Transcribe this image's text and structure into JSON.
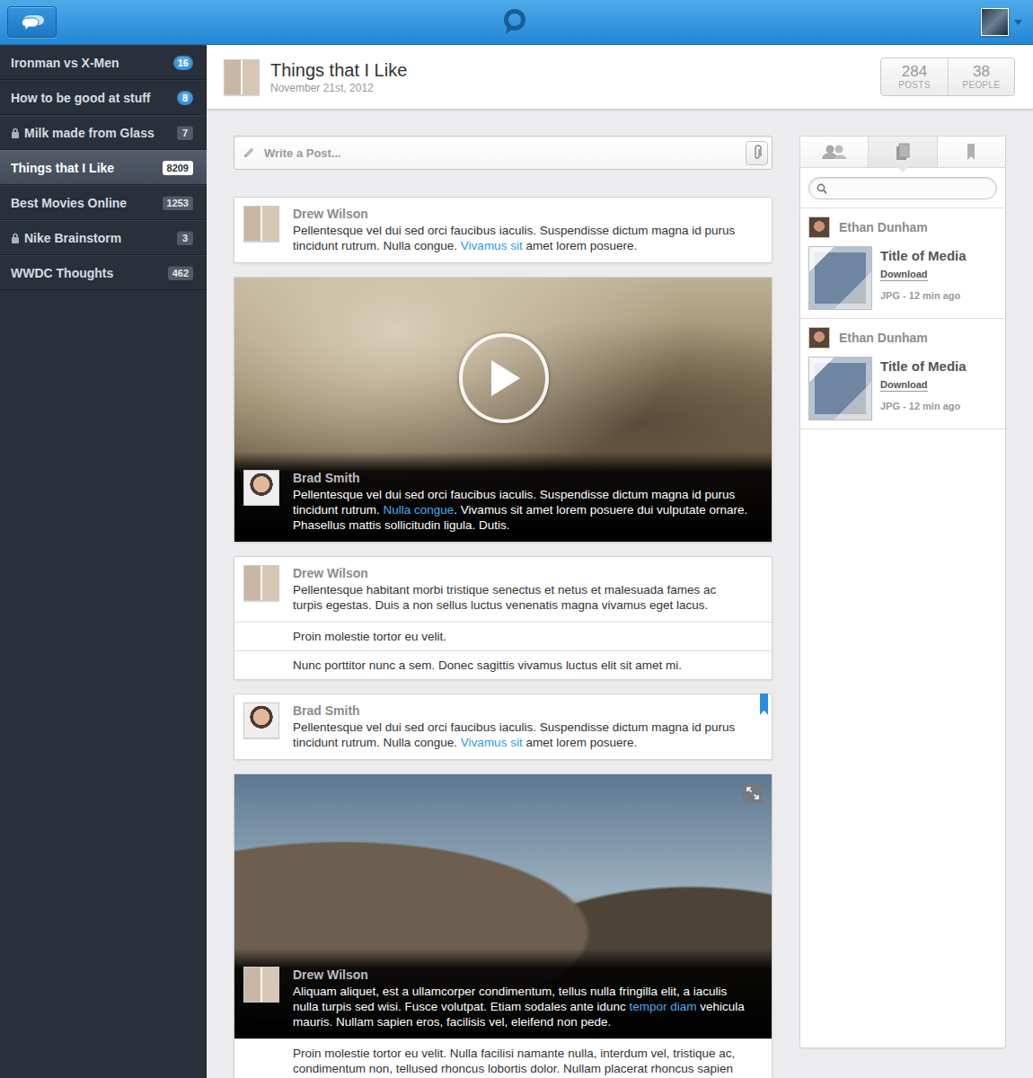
{
  "sidebar": {
    "items": [
      {
        "label": "Ironman vs X-Men",
        "count": "16",
        "locked": false,
        "unread": true,
        "selected": false
      },
      {
        "label": "How to be good at stuff",
        "count": "8",
        "locked": false,
        "unread": true,
        "selected": false
      },
      {
        "label": "Milk made from Glass",
        "count": "7",
        "locked": true,
        "unread": false,
        "selected": false
      },
      {
        "label": "Things that I Like",
        "count": "8209",
        "locked": false,
        "unread": false,
        "selected": true
      },
      {
        "label": "Best Movies Online",
        "count": "1253",
        "locked": false,
        "unread": false,
        "selected": false
      },
      {
        "label": "Nike Brainstorm",
        "count": "3",
        "locked": true,
        "unread": false,
        "selected": false
      },
      {
        "label": "WWDC Thoughts",
        "count": "462",
        "locked": false,
        "unread": false,
        "selected": false
      }
    ]
  },
  "header": {
    "title": "Things that I Like",
    "date": "November 21st, 2012",
    "stats": [
      {
        "value": "284",
        "label": "POSTS"
      },
      {
        "value": "38",
        "label": "PEOPLE"
      }
    ]
  },
  "composer": {
    "placeholder": "Write a Post..."
  },
  "feed": [
    {
      "kind": "text",
      "author": "Drew Wilson",
      "bookmarked": false,
      "segments": [
        {
          "text": "Pellentesque vel dui sed orci faucibus iaculis. Suspendisse dictum magna id purus tincidunt rutrum. Nulla congue. ",
          "link": false
        },
        {
          "text": "Vivamus sit",
          "link": true
        },
        {
          "text": " amet lorem posuere.",
          "link": false
        }
      ],
      "replies": []
    },
    {
      "kind": "video",
      "author": "Brad Smith",
      "bookmarked": false,
      "segments": [
        {
          "text": "Pellentesque vel dui sed orci faucibus iaculis. Suspendisse dictum magna id purus tincidunt rutrum. ",
          "link": false
        },
        {
          "text": "Nulla congue",
          "link": true
        },
        {
          "text": ". Vivamus sit amet lorem posuere dui vulputate ornare. Phasellus mattis sollicitudin ligula. Dutis.",
          "link": false
        }
      ],
      "replies": []
    },
    {
      "kind": "text",
      "author": "Drew Wilson",
      "bookmarked": false,
      "segments": [
        {
          "text": "Pellentesque habitant morbi tristique senectus et netus et malesuada fames ac turpis egestas. Duis a non sellus luctus venenatis magna vivamus eget lacus.",
          "link": false
        }
      ],
      "replies": [
        "Proin molestie tortor eu velit.",
        "Nunc porttitor nunc a sem. Donec sagittis vivamus luctus elit sit amet mi."
      ]
    },
    {
      "kind": "text",
      "author": "Brad Smith",
      "bookmarked": true,
      "segments": [
        {
          "text": "Pellentesque vel dui sed orci faucibus iaculis. Suspendisse dictum magna id purus tincidunt rutrum. Nulla congue. ",
          "link": false
        },
        {
          "text": "Vivamus sit",
          "link": true
        },
        {
          "text": " amet lorem posuere.",
          "link": false
        }
      ],
      "replies": []
    },
    {
      "kind": "photo",
      "author": "Drew Wilson",
      "bookmarked": false,
      "segments": [
        {
          "text": "Aliquam aliquet, est a ullamcorper condimentum, tellus nulla fringilla elit, a iaculis nulla turpis sed wisi. Fusce volutpat. Etiam sodales ante idunc ",
          "link": false
        },
        {
          "text": "tempor diam",
          "link": true
        },
        {
          "text": " vehicula mauris. Nullam sapien eros, facilisis vel, eleifend non pede.",
          "link": false
        }
      ],
      "replies": [
        "Proin molestie tortor eu velit. Nulla facilisi namante nulla, interdum vel, tristique ac, condimentum non, tellused rhoncus lobortis dolor. Nullam placerat rhoncus sapien"
      ]
    }
  ],
  "side_panel": {
    "tabs": [
      {
        "selected": false
      },
      {
        "selected": true
      },
      {
        "selected": false
      }
    ],
    "search": {
      "value": ""
    },
    "media": [
      {
        "author": "Ethan Dunham",
        "title": "Title of Media",
        "action": "Download",
        "meta": "JPG - 12 min ago"
      },
      {
        "author": "Ethan Dunham",
        "title": "Title of Media",
        "action": "Download",
        "meta": "JPG - 12 min ago"
      }
    ]
  }
}
